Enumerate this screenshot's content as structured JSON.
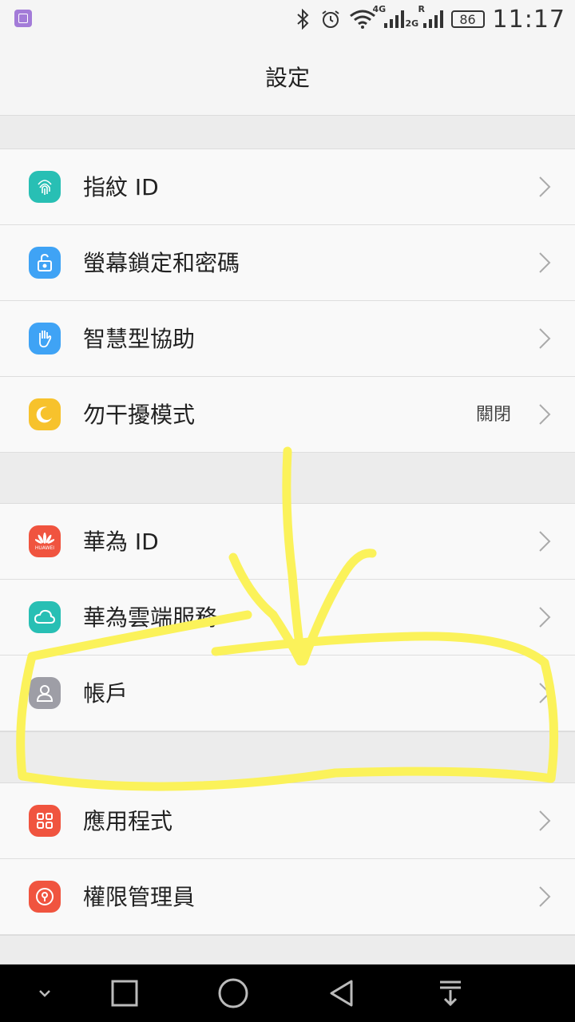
{
  "status_bar": {
    "time": "11:17",
    "battery": "86",
    "net1": "4G",
    "net2": "2G",
    "roaming": "R"
  },
  "header": {
    "title": "設定"
  },
  "groups": [
    [
      {
        "label": "指紋 ID",
        "icon": "fingerprint-icon",
        "color": "#28bfb4",
        "value": ""
      },
      {
        "label": "螢幕鎖定和密碼",
        "icon": "unlock-icon",
        "color": "#3fa3f5",
        "value": ""
      },
      {
        "label": "智慧型協助",
        "icon": "hand-icon",
        "color": "#3fa3f5",
        "value": ""
      },
      {
        "label": "勿干擾模式",
        "icon": "moon-icon",
        "color": "#f7c22c",
        "value": "關閉"
      }
    ],
    [
      {
        "label": "華為 ID",
        "icon": "huawei-logo-icon",
        "color": "#f0543f",
        "value": ""
      },
      {
        "label": "華為雲端服務",
        "icon": "cloud-icon",
        "color": "#28bfb4",
        "value": ""
      },
      {
        "label": "帳戶",
        "icon": "person-icon",
        "color": "#9e9ea6",
        "value": ""
      }
    ],
    [
      {
        "label": "應用程式",
        "icon": "apps-grid-icon",
        "color": "#f0543f",
        "value": ""
      },
      {
        "label": "權限管理員",
        "icon": "permission-icon",
        "color": "#f0543f",
        "value": ""
      }
    ]
  ],
  "huawei_logo_text": "HUAWEI",
  "annotation_color": "#fbf25a"
}
